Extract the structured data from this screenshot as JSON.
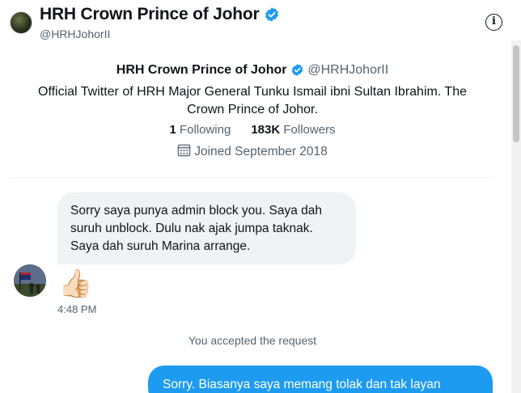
{
  "header": {
    "name": "HRH Crown Prince of Johor",
    "handle": "@HRHJohorII"
  },
  "profile": {
    "name": "HRH Crown Prince of Johor",
    "handle": "@HRHJohorII",
    "bio": "Official Twitter of HRH Major General Tunku Ismail ibni Sultan Ibrahim. The Crown Prince of Johor.",
    "following_count": "1",
    "following_label": "Following",
    "followers_count": "183K",
    "followers_label": "Followers",
    "joined": "Joined September 2018"
  },
  "messages": {
    "incoming_text": "Sorry saya punya admin block you. Saya dah suruh unblock. Dulu nak ajak jumpa taknak. Saya dah suruh Marina arrange.",
    "reaction_emoji": "👍🏻",
    "timestamp": "4:48 PM",
    "system_notice": "You accepted the request",
    "outgoing_text": "Sorry. Biasanya saya memang tolak dan tak layan"
  },
  "colors": {
    "accent": "#1d9bf0",
    "verified": "#1d9bf0",
    "muted_text": "#536471",
    "incoming_bubble": "#eff3f4"
  },
  "icons": {
    "verified": "verified-badge-icon",
    "info": "info-icon",
    "calendar": "calendar-icon"
  }
}
